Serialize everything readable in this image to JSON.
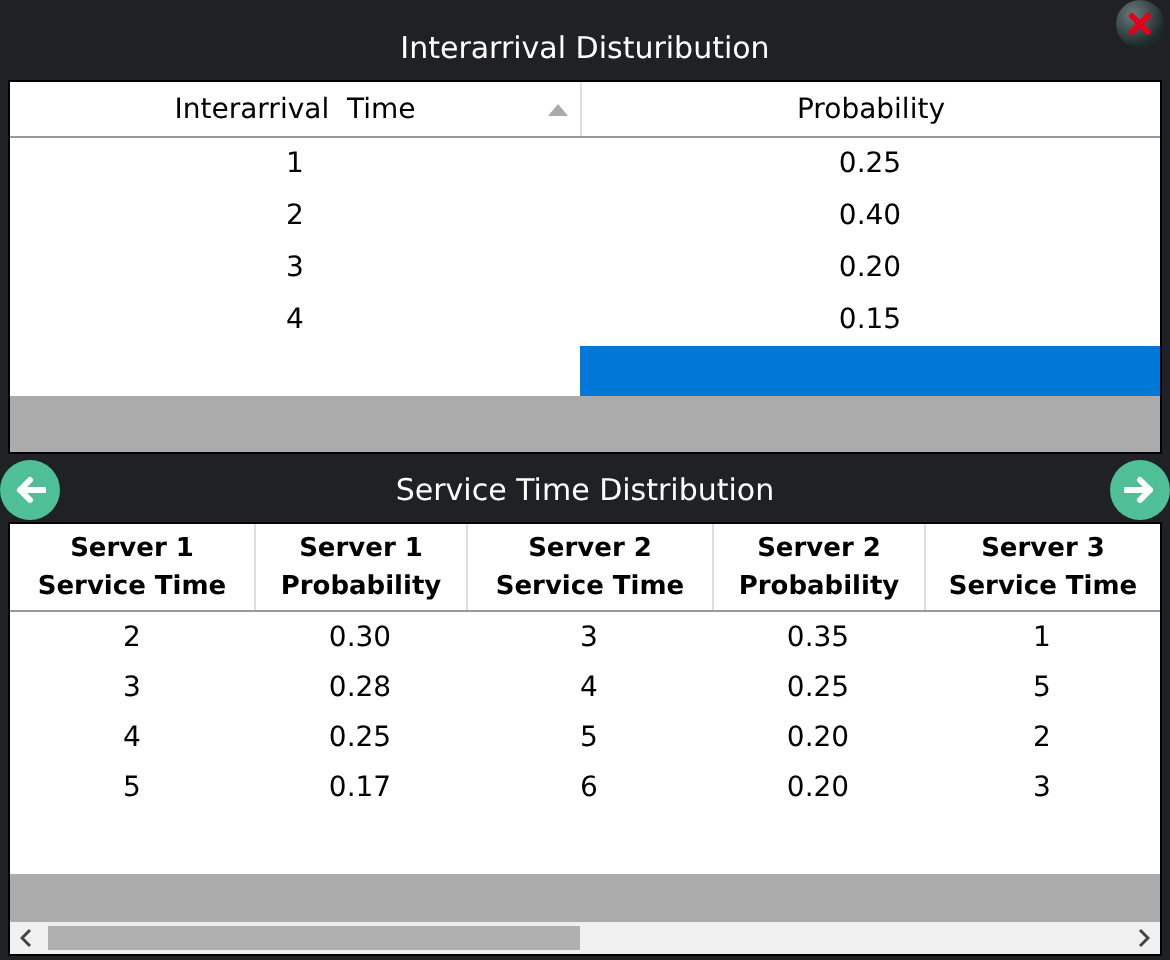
{
  "interarrival": {
    "title": "Interarrival Disturibution",
    "columns": [
      {
        "label": "Interarrival  Time",
        "sorted": true
      },
      {
        "label": "Probability",
        "sorted": false
      }
    ],
    "rows": [
      [
        "1",
        "0.25"
      ],
      [
        "2",
        "0.40"
      ],
      [
        "3",
        "0.20"
      ],
      [
        "4",
        "0.15"
      ]
    ],
    "blank_row": {
      "probability_cell_selected": true
    }
  },
  "service": {
    "title": "Service Time Distribution",
    "columns": [
      "Server 1 Service Time",
      "Server 1 Probability",
      "Server 2 Service Time",
      "Server 2 Probability",
      "Server 3 Service Time"
    ],
    "rows": [
      [
        "2",
        "0.30",
        "3",
        "0.35",
        "1"
      ],
      [
        "3",
        "0.28",
        "4",
        "0.25",
        "5"
      ],
      [
        "4",
        "0.25",
        "5",
        "0.20",
        "2"
      ],
      [
        "5",
        "0.17",
        "6",
        "0.20",
        "3"
      ]
    ]
  }
}
